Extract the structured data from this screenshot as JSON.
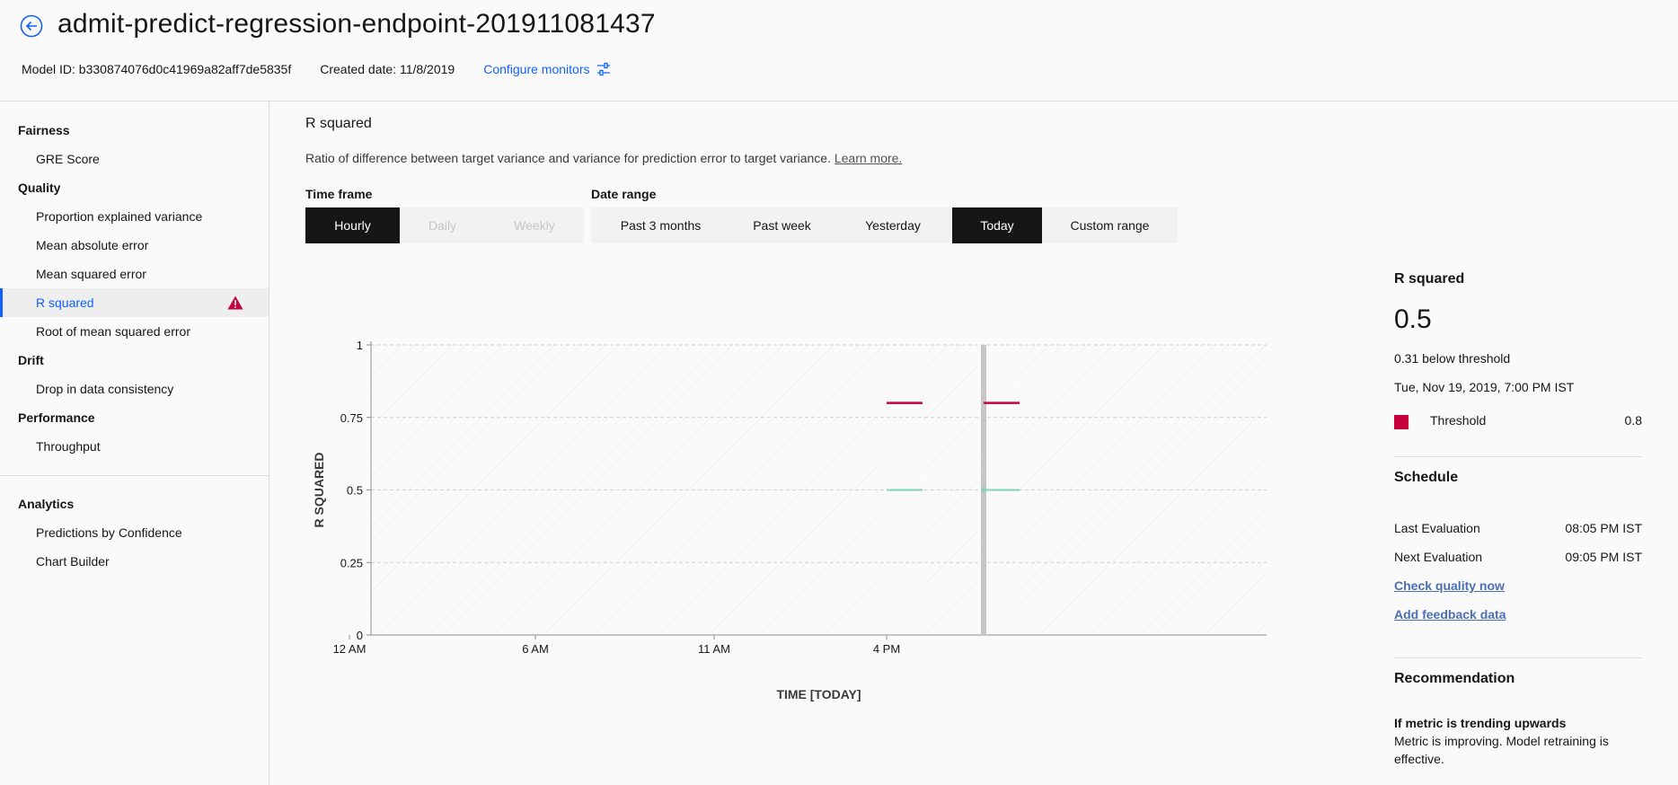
{
  "header": {
    "title": "admit-predict-regression-endpoint-201911081437",
    "model_id": "Model ID: b330874076d0c41969a82aff7de5835f",
    "created_date": "Created date: 11/8/2019",
    "configure_label": "Configure monitors"
  },
  "sidebar": {
    "groups": [
      {
        "label": "Fairness",
        "items": [
          "GRE Score"
        ]
      },
      {
        "label": "Quality",
        "items": [
          "Proportion explained variance",
          "Mean absolute error",
          "Mean squared error",
          "R squared",
          "Root of mean squared error"
        ]
      },
      {
        "label": "Drift",
        "items": [
          "Drop in data consistency"
        ]
      },
      {
        "label": "Performance",
        "items": [
          "Throughput"
        ]
      },
      {
        "label": "Analytics",
        "items": [
          "Predictions by Confidence",
          "Chart Builder"
        ]
      }
    ],
    "active_item": "R squared"
  },
  "main": {
    "title": "R squared",
    "description": "Ratio of difference between target variance and variance for prediction error to target variance.",
    "learn_more": "Learn more.",
    "time_frame_label": "Time frame",
    "time_frame": [
      "Hourly",
      "Daily",
      "Weekly"
    ],
    "time_frame_selected": "Hourly",
    "date_range_label": "Date range",
    "date_range": [
      "Past 3 months",
      "Past week",
      "Yesterday",
      "Today",
      "Custom range"
    ],
    "date_range_selected": "Today"
  },
  "chart_data": {
    "type": "line",
    "xlabel": "TIME [TODAY]",
    "ylabel": "R SQUARED",
    "ylim": [
      0,
      1
    ],
    "yticks": [
      "0",
      "0.25",
      "0.5",
      "0.75",
      "1"
    ],
    "xticks": [
      "12 AM",
      "6 AM",
      "11 AM",
      "4 PM"
    ],
    "grid": true,
    "series": [
      {
        "name": "Threshold",
        "color": "#c8003d",
        "points": [
          {
            "x": "4 PM",
            "y": 0.8
          },
          {
            "x": "7 PM",
            "y": 0.8
          }
        ]
      },
      {
        "name": "R squared",
        "color": "#7fd1b9",
        "points": [
          {
            "x": "4 PM",
            "y": 0.5
          },
          {
            "x": "7 PM",
            "y": 0.5
          }
        ]
      }
    ],
    "selected_x": "7 PM"
  },
  "panel": {
    "title": "R squared",
    "value": "0.5",
    "below_threshold": "0.31 below threshold",
    "timestamp": "Tue, Nov 19, 2019, 7:00 PM IST",
    "threshold_label": "Threshold",
    "threshold_value": "0.8",
    "threshold_color": "#c8003d",
    "schedule_title": "Schedule",
    "last_eval_label": "Last Evaluation",
    "last_eval_value": "08:05 PM IST",
    "next_eval_label": "Next Evaluation",
    "next_eval_value": "09:05 PM IST",
    "check_quality": "Check quality now",
    "add_feedback": "Add feedback data",
    "recommendation_title": "Recommendation",
    "rec_heading": "If metric is trending upwards",
    "rec_text_1": "Metric is improving. Model retraining is",
    "rec_text_2": "effective."
  }
}
